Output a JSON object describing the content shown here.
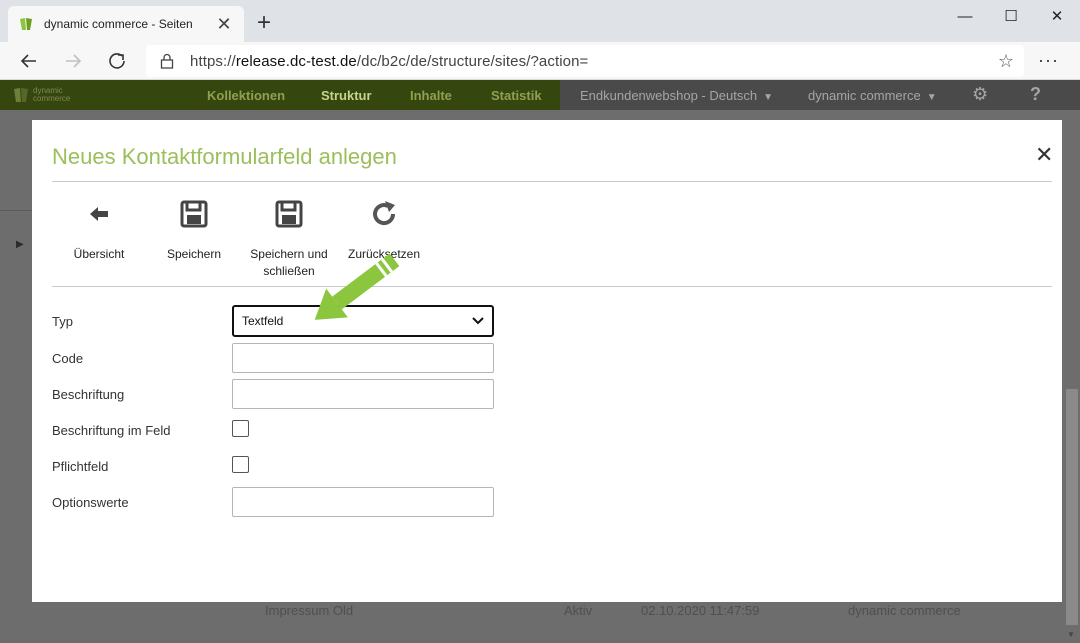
{
  "browser": {
    "tab_title": "dynamic commerce - Seiten",
    "tab_close": "✕",
    "new_tab": "+",
    "url_prefix": "https://",
    "url_host": "release.dc-test.de",
    "url_path": "/dc/b2c/de/structure/sites/?action=",
    "window_minimize": "—",
    "window_maximize": "☐",
    "window_close": "✕",
    "more_menu": "···"
  },
  "app": {
    "logo_text_top": "dynamic",
    "logo_text_bottom": "commerce",
    "nav": [
      "Kollektionen",
      "Struktur",
      "Inhalte",
      "Statistik"
    ],
    "shop_select": "Endkundenwebshop - Deutsch",
    "company_select": "dynamic commerce",
    "help": "?"
  },
  "background": {
    "row_name": "Impressum Old",
    "row_status": "Aktiv",
    "row_date": "02.10.2020 11:47:59",
    "row_owner": "dynamic commerce"
  },
  "modal": {
    "title": "Neues Kontaktformularfeld anlegen",
    "close": "✕",
    "toolbar": {
      "overview": "Übersicht",
      "save": "Speichern",
      "save_close_1": "Speichern und",
      "save_close_2": "schließen",
      "reset": "Zurücksetzen"
    },
    "form": {
      "type_label": "Typ",
      "type_value": "Textfeld",
      "code_label": "Code",
      "caption_label": "Beschriftung",
      "caption_in_field_label": "Beschriftung im Feld",
      "required_label": "Pflichtfeld",
      "option_values_label": "Optionswerte"
    }
  },
  "colors": {
    "accent_green": "#9bbf5b",
    "app_header_dimmed": "#36460f",
    "hint_arrow": "#8cc63f"
  },
  "icons": {
    "back": "arrow-left-icon",
    "forward": "arrow-right-icon",
    "reload": "reload-icon",
    "lock": "lock-icon",
    "favorite": "star-icon",
    "settings": "gear-icon"
  }
}
